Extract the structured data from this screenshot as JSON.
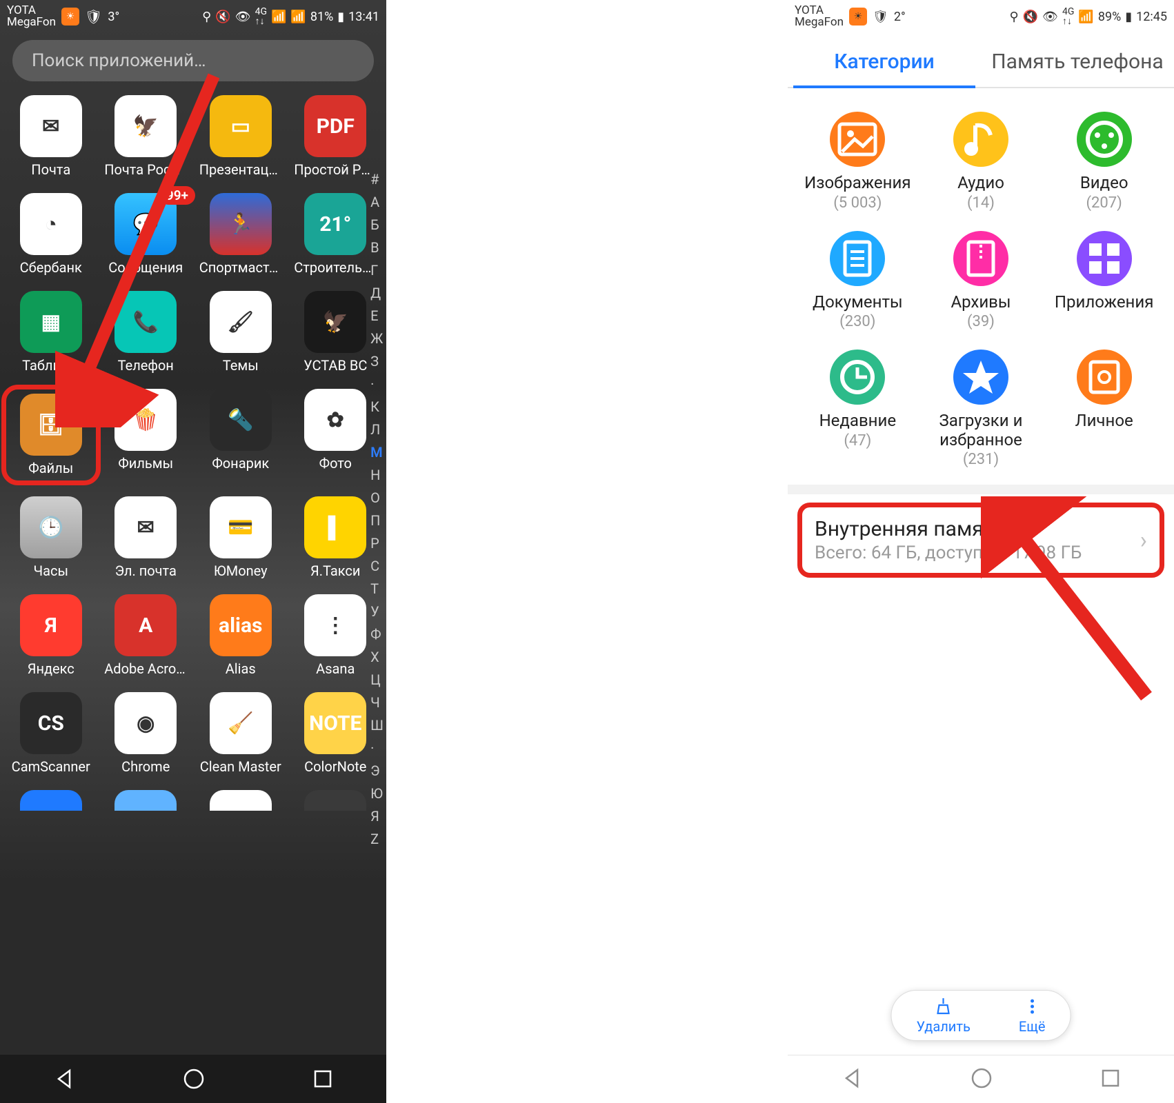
{
  "left": {
    "status": {
      "carrier1": "YOTA",
      "carrier2": "MegaFon",
      "temp": "3°",
      "battery": "81%",
      "time": "13:41"
    },
    "search_placeholder": "Поиск приложений…",
    "apps": [
      {
        "key": "mail",
        "label": "Почта"
      },
      {
        "key": "post",
        "label": "Почта России"
      },
      {
        "key": "slides",
        "label": "Презентации"
      },
      {
        "key": "pdf",
        "label": "Простой PDF-.."
      },
      {
        "key": "sber",
        "label": "Сбербанк"
      },
      {
        "key": "msg",
        "label": "Сообщения",
        "badge": "99+"
      },
      {
        "key": "sport",
        "label": "Спортмастер"
      },
      {
        "key": "build",
        "label": "Строительны.."
      },
      {
        "key": "sheets",
        "label": "Таблицы"
      },
      {
        "key": "phone",
        "label": "Телефон"
      },
      {
        "key": "themes",
        "label": "Темы"
      },
      {
        "key": "ustav",
        "label": "УСТАВ ВС"
      },
      {
        "key": "files",
        "label": "Файлы",
        "highlighted": true
      },
      {
        "key": "films",
        "label": "Фильмы"
      },
      {
        "key": "torch",
        "label": "Фонарик"
      },
      {
        "key": "photos",
        "label": "Фото"
      },
      {
        "key": "clock",
        "label": "Часы"
      },
      {
        "key": "email",
        "label": "Эл. почта"
      },
      {
        "key": "umoney",
        "label": "ЮMoney"
      },
      {
        "key": "taxi",
        "label": "Я.Такси"
      },
      {
        "key": "yandex",
        "label": "Яндекс"
      },
      {
        "key": "acrobat",
        "label": "Adobe Acrobat"
      },
      {
        "key": "alias",
        "label": "Alias"
      },
      {
        "key": "asana",
        "label": "Asana"
      },
      {
        "key": "cs",
        "label": "CamScanner"
      },
      {
        "key": "chrome",
        "label": "Chrome"
      },
      {
        "key": "clean",
        "label": "Clean Master"
      },
      {
        "key": "note",
        "label": "ColorNote"
      }
    ],
    "index_letters": [
      "#",
      "А",
      "Б",
      "В",
      "Г",
      "Д",
      "Е",
      "Ж",
      "З",
      "·",
      "К",
      "Л",
      "М",
      "Н",
      "О",
      "П",
      "Р",
      "С",
      "Т",
      "У",
      "Ф",
      "Х",
      "Ц",
      "Ч",
      "Ш",
      "·",
      "Э",
      "Ю",
      "Я",
      "Z"
    ],
    "index_active": "М",
    "icon_glyph": {
      "mail": "✉",
      "post": "🦅",
      "slides": "▭",
      "pdf": "PDF",
      "sber": "◔",
      "msg": "💬",
      "sport": "🏃",
      "build": "21°",
      "sheets": "▦",
      "phone": "📞",
      "themes": "🖌",
      "ustav": "🦅",
      "files": "🗄",
      "films": "🍿",
      "torch": "🔦",
      "photos": "✿",
      "clock": "🕒",
      "email": "✉",
      "umoney": "💳",
      "taxi": "▌",
      "yandex": "Я",
      "acrobat": "A",
      "alias": "alias",
      "asana": "⋮",
      "cs": "CS",
      "chrome": "◉",
      "clean": "🧹",
      "note": "NOTE"
    }
  },
  "right": {
    "status": {
      "carrier1": "YOTA",
      "carrier2": "MegaFon",
      "temp": "2°",
      "battery": "89%",
      "time": "12:45"
    },
    "tabs": {
      "a": "Категории",
      "b": "Память телефона"
    },
    "categories": [
      {
        "name": "Изображения",
        "count": "(5 003)",
        "color": "#ff7b1a",
        "glyph": "image"
      },
      {
        "name": "Аудио",
        "count": "(14)",
        "color": "#ffc21a",
        "glyph": "music"
      },
      {
        "name": "Видео",
        "count": "(207)",
        "color": "#2dbb2d",
        "glyph": "video"
      },
      {
        "name": "Документы",
        "count": "(230)",
        "color": "#1fa9ff",
        "glyph": "doc"
      },
      {
        "name": "Архивы",
        "count": "(39)",
        "color": "#ff2da6",
        "glyph": "zip"
      },
      {
        "name": "Приложения",
        "count": "",
        "color": "#8a4dff",
        "glyph": "apps"
      },
      {
        "name": "Недавние",
        "count": "(47)",
        "color": "#2dbb8a",
        "glyph": "recent"
      },
      {
        "name": "Загрузки и избранное",
        "count": "(231)",
        "color": "#1f7aff",
        "glyph": "star"
      },
      {
        "name": "Личное",
        "count": "",
        "color": "#ff7b1a",
        "glyph": "safe"
      }
    ],
    "storage": {
      "title": "Внутренняя память",
      "subtitle": "Всего: 64 ГБ, доступно: 17,98 ГБ"
    },
    "bottom": {
      "clean": "Удалить",
      "more": "Ещё"
    }
  }
}
